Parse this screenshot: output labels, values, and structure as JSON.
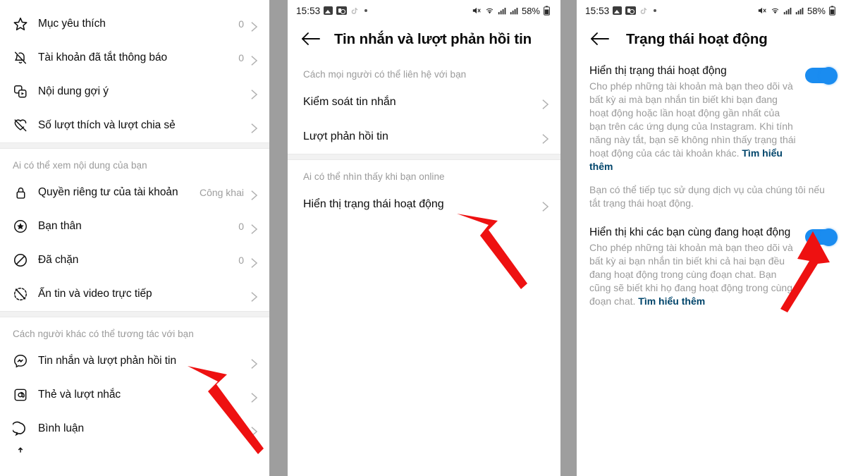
{
  "statusbar": {
    "time": "15:53",
    "battery_pct": "58%",
    "icons": [
      "image-icon",
      "camera-icon",
      "tiktok-icon",
      "dot-icon",
      "mute-icon",
      "wifi-icon",
      "signal-icon",
      "signal-icon-2",
      "battery-icon"
    ]
  },
  "panel1": {
    "sections": [
      {
        "label": "",
        "rows": [
          {
            "icon": "star-icon",
            "label": "Mục yêu thích",
            "value": "0"
          },
          {
            "icon": "bell-off-icon",
            "label": "Tài khoản đã tắt thông báo",
            "value": "0"
          },
          {
            "icon": "suggested-icon",
            "label": "Nội dung gợi ý",
            "value": ""
          },
          {
            "icon": "heart-off-icon",
            "label": "Số lượt thích và lượt chia sẻ",
            "value": ""
          }
        ]
      },
      {
        "label": "Ai có thể xem nội dung của bạn",
        "rows": [
          {
            "icon": "lock-icon",
            "label": "Quyền riêng tư của tài khoản",
            "value": "Công khai"
          },
          {
            "icon": "close-friend-icon",
            "label": "Bạn thân",
            "value": "0"
          },
          {
            "icon": "block-icon",
            "label": "Đã chặn",
            "value": "0"
          },
          {
            "icon": "hide-story-icon",
            "label": "Ẩn tin và video trực tiếp",
            "value": ""
          }
        ]
      },
      {
        "label": "Cách người khác có thể tương tác với bạn",
        "rows": [
          {
            "icon": "messenger-icon",
            "label": "Tin nhắn và lượt phản hồi tin",
            "value": ""
          },
          {
            "icon": "at-icon",
            "label": "Thẻ và lượt nhắc",
            "value": ""
          },
          {
            "icon": "comment-icon",
            "label": "Bình luận",
            "value": ""
          }
        ]
      }
    ]
  },
  "panel2": {
    "title": "Tin nhắn và lượt phản hồi tin",
    "back": "back-arrow",
    "sections": [
      {
        "label": "Cách mọi người có thể liên hệ với bạn",
        "rows": [
          {
            "label": "Kiểm soát tin nhắn"
          },
          {
            "label": "Lượt phản hồi tin"
          }
        ]
      },
      {
        "label": "Ai có thể nhìn thấy khi bạn online",
        "rows": [
          {
            "label": "Hiển thị trạng thái hoạt động"
          }
        ]
      }
    ]
  },
  "panel3": {
    "title": "Trạng thái hoạt động",
    "back": "back-arrow",
    "toggles": [
      {
        "title": "Hiển thị trạng thái hoạt động",
        "desc": "Cho phép những tài khoản mà bạn theo dõi và bất kỳ ai mà bạn nhắn tin biết khi bạn đang hoạt động hoặc lần hoạt động gần nhất của bạn trên các ứng dụng của Instagram. Khi tính năng này tắt, bạn sẽ không nhìn thấy trạng thái hoạt động của các tài khoản khác. ",
        "link": "Tìm hiểu thêm",
        "on": true
      },
      {
        "title": "Hiển thị khi các bạn cùng đang hoạt động",
        "desc": "Cho phép những tài khoản mà bạn theo dõi và bất kỳ ai bạn nhắn tin biết khi cả hai bạn đều đang hoạt động trong cùng đoạn chat. Bạn cũng sẽ biết khi họ đang hoạt động trong cùng đoạn chat. ",
        "link": "Tìm hiểu thêm",
        "on": true
      }
    ],
    "note": "Bạn có thể tiếp tục sử dụng dịch vụ của chúng tôi nếu tắt trạng thái hoạt động."
  },
  "annotations": {
    "arrow_color": "#ee1111",
    "arrows": [
      {
        "name": "arrow-to-messages-row"
      },
      {
        "name": "arrow-to-activity-status-row"
      },
      {
        "name": "arrow-to-second-toggle"
      }
    ]
  },
  "colors": {
    "toggle_on": "#1a8cf0",
    "link": "#00456b",
    "muted_text": "#9b9b9b",
    "panel_gap": "#9e9e9e"
  }
}
